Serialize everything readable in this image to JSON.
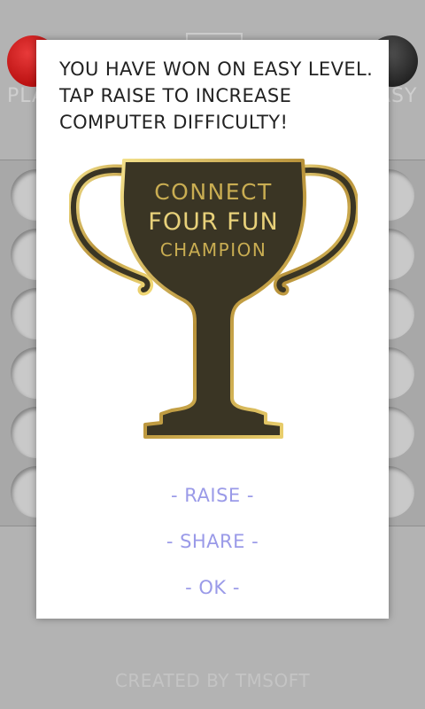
{
  "background": {
    "left_label": "PLA",
    "right_label": "ASY",
    "footer": "CREATED BY TMSOFT"
  },
  "dialog": {
    "message_line1": "YOU HAVE WON ON EASY LEVEL.",
    "message_line2": "TAP RAISE TO INCREASE",
    "message_line3": "COMPUTER DIFFICULTY!",
    "trophy_line1": "CONNECT",
    "trophy_line2": "FOUR FUN",
    "trophy_line3": "CHAMPION",
    "raise_label": "- RAISE -",
    "share_label": "- SHARE -",
    "ok_label": "- OK -"
  },
  "colors": {
    "action_text": "#9a9ae8",
    "trophy_body": "#3a3524",
    "trophy_gold": "#c9ad52"
  }
}
